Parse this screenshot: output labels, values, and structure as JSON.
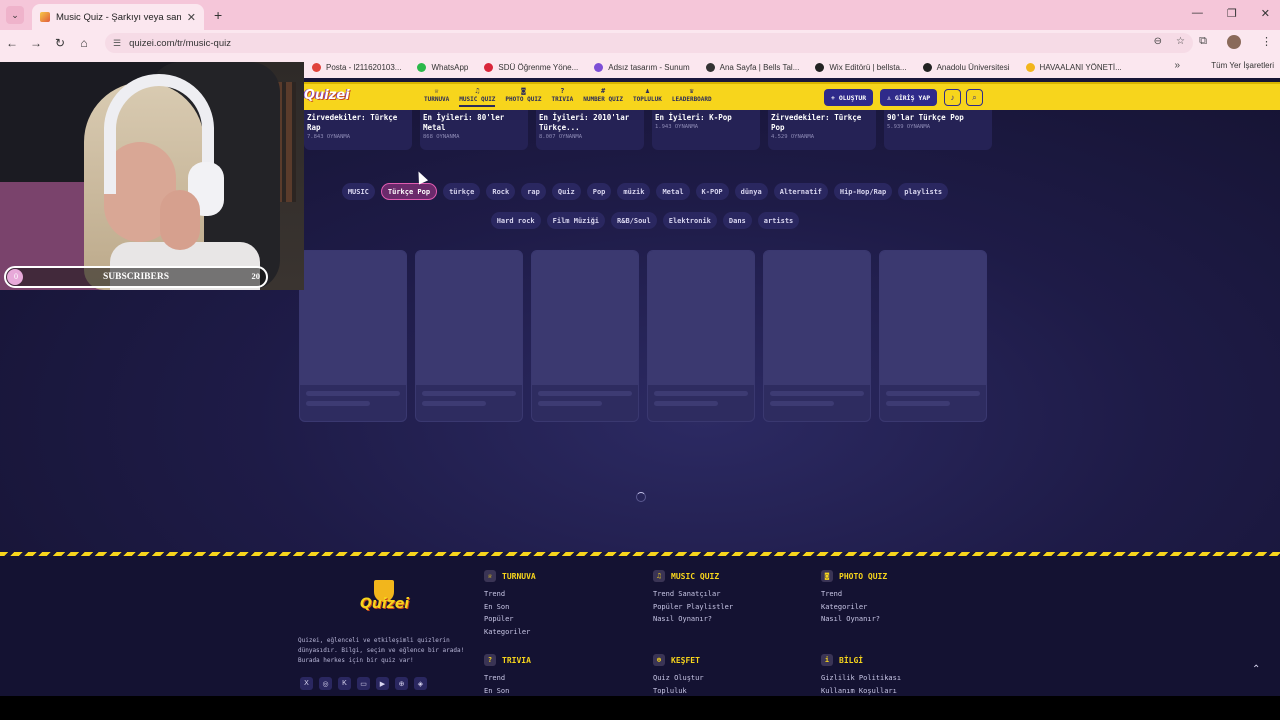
{
  "browser": {
    "tab_title": "Music Quiz - Şarkıyı veya sanat",
    "url": "quizei.com/tr/music-quiz",
    "bookmarks": [
      "Posta - l211620103...",
      "WhatsApp",
      "SDÜ Öğrenme Yöne...",
      "Adsız tasarım - Sunum",
      "Ana Sayfa | Bells Tal...",
      "Wix Editörü | bellsta...",
      "Anadolu Üniversitesi",
      "HAVAALANI YÖNETİ..."
    ],
    "bookmark_colors": [
      "#e0433b",
      "#2bb84a",
      "#d9263a",
      "#7d4fd6",
      "#333333",
      "#222222",
      "#222222",
      "#f2b51c"
    ],
    "all_bookmarks": "Tüm Yer İşaretleri"
  },
  "site": {
    "logo": "Quizei",
    "menu": [
      {
        "icon": "trophy-icon",
        "glyph": "♕",
        "label": "TURNUVA"
      },
      {
        "icon": "music-icon",
        "glyph": "♫",
        "label": "MUSIC QUIZ"
      },
      {
        "icon": "camera-icon",
        "glyph": "◙",
        "label": "PHOTO QUIZ"
      },
      {
        "icon": "help-icon",
        "glyph": "?",
        "label": "TRIVIA"
      },
      {
        "icon": "hash-icon",
        "glyph": "#",
        "label": "NUMBER QUIZ"
      },
      {
        "icon": "users-icon",
        "glyph": "♟",
        "label": "TOPLULUK"
      },
      {
        "icon": "crown-icon",
        "glyph": "♛",
        "label": "LEADERBOARD"
      }
    ],
    "create_label": "+ OLUŞTUR",
    "login_label": "GİRİŞ YAP"
  },
  "playlists": [
    {
      "title": "Zirvedekiler: Türkçe Rap",
      "plays": "7.843 OYNANMA"
    },
    {
      "title": "En İyileri: 80'ler Metal",
      "plays": "868 OYNANMA"
    },
    {
      "title": "En İyileri: 2010'lar Türkçe...",
      "plays": "8.007 OYNANMA"
    },
    {
      "title": "En İyileri: K-Pop",
      "plays": "1.943 OYNANMA"
    },
    {
      "title": "Zirvedekiler: Türkçe Pop",
      "plays": "4.529 OYNANMA"
    },
    {
      "title": "90'lar Türkçe Pop",
      "plays": "5.939 OYNANMA"
    }
  ],
  "categories": [
    "MUSIC",
    "Türkçe Pop",
    "türkçe",
    "Rock",
    "rap",
    "Quiz",
    "Pop",
    "müzik",
    "Metal",
    "K-POP",
    "dünya",
    "Alternatif",
    "Hip-Hop/Rap",
    "playlists",
    "Hard rock",
    "Film Müziği",
    "R&B/Soul",
    "Elektronik",
    "Dans",
    "artists"
  ],
  "active_category": "Türkçe Pop",
  "footer": {
    "about": "Quizei, eğlenceli ve etkileşimli quizlerin dünyasıdır. Bilgi, seçim ve eğlence bir arada! Burada herkes için bir quiz var!",
    "socials": [
      "X",
      "◎",
      "K",
      "▭",
      "▶",
      "⊕",
      "◈"
    ],
    "columns": [
      {
        "title": "TURNUVA",
        "glyph": "♕",
        "links": [
          "Trend",
          "En Son",
          "Popüler",
          "Kategoriler"
        ]
      },
      {
        "title": "MUSIC QUIZ",
        "glyph": "♫",
        "links": [
          "Trend Sanatçılar",
          "Popüler Playlistler",
          "Nasıl Oynanır?"
        ]
      },
      {
        "title": "PHOTO QUIZ",
        "glyph": "◙",
        "links": [
          "Trend",
          "Kategoriler",
          "Nasıl Oynanır?"
        ]
      },
      {
        "title": "TRIVIA",
        "glyph": "?",
        "links": [
          "Trend",
          "En Son"
        ]
      },
      {
        "title": "KEŞFET",
        "glyph": "⊕",
        "links": [
          "Quiz Oluştur",
          "Topluluk"
        ]
      },
      {
        "title": "BİLGİ",
        "glyph": "i",
        "links": [
          "Gizlilik Politikası",
          "Kullanım Koşulları"
        ]
      }
    ]
  },
  "overlay": {
    "subscribers_label": "SUBSCRIBERS",
    "min": "0",
    "max": "20",
    "progress": 0.0
  }
}
